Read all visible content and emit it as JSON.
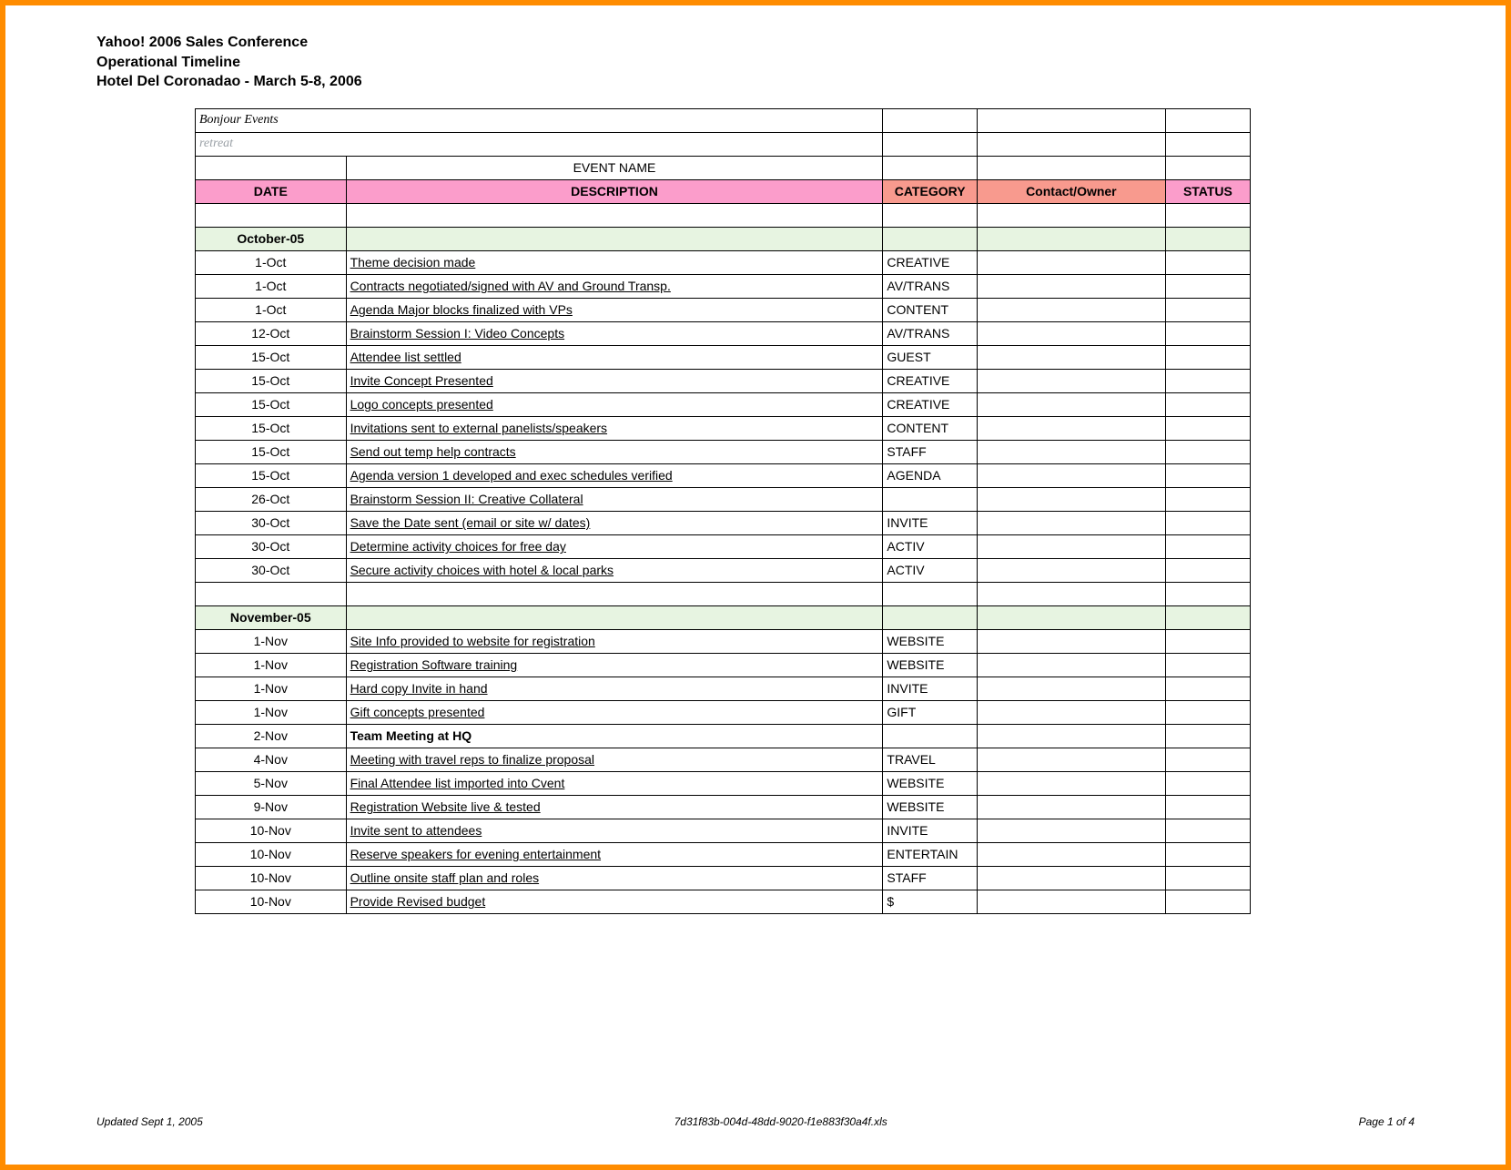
{
  "header": {
    "line1": "Yahoo! 2006 Sales Conference",
    "line2": "Operational Timeline",
    "line3": "Hotel Del Coronadao - March 5-8, 2006"
  },
  "top": {
    "brand": "Bonjour Events",
    "retreat": "retreat",
    "event_name": "EVENT NAME"
  },
  "columns": {
    "date": "DATE",
    "description": "DESCRIPTION",
    "category": "CATEGORY",
    "owner": "Contact/Owner",
    "status": "STATUS"
  },
  "sections": [
    {
      "month": "October-05",
      "rows": [
        {
          "date": "1-Oct",
          "desc": "Theme decision made",
          "cat": "CREATIVE"
        },
        {
          "date": "1-Oct",
          "desc": "Contracts negotiated/signed with AV and Ground Transp.",
          "cat": "AV/TRANS"
        },
        {
          "date": "1-Oct",
          "desc": "Agenda Major blocks finalized with VPs",
          "cat": "CONTENT"
        },
        {
          "date": "12-Oct",
          "desc": "Brainstorm Session I: Video Concepts",
          "cat": "AV/TRANS"
        },
        {
          "date": "15-Oct",
          "desc": "Attendee list settled",
          "cat": "GUEST"
        },
        {
          "date": "15-Oct",
          "desc": "Invite Concept Presented",
          "cat": "CREATIVE"
        },
        {
          "date": "15-Oct",
          "desc": "Logo concepts presented",
          "cat": "CREATIVE"
        },
        {
          "date": "15-Oct",
          "desc": "Invitations sent to external panelists/speakers",
          "cat": "CONTENT"
        },
        {
          "date": "15-Oct",
          "desc": "Send out temp help contracts",
          "cat": "STAFF"
        },
        {
          "date": "15-Oct",
          "desc": "Agenda version 1 developed and exec schedules verified",
          "cat": "AGENDA"
        },
        {
          "date": "26-Oct",
          "desc": "Brainstorm Session II: Creative Collateral",
          "cat": ""
        },
        {
          "date": "30-Oct",
          "desc": "Save the Date sent (email or site w/ dates)",
          "cat": "INVITE"
        },
        {
          "date": "30-Oct",
          "desc": "Determine activity choices for free day",
          "cat": "ACTIV"
        },
        {
          "date": "30-Oct",
          "desc": "Secure activity choices with hotel & local parks",
          "cat": "ACTIV"
        }
      ]
    },
    {
      "month": "November-05",
      "rows": [
        {
          "date": "1-Nov",
          "desc": "Site Info provided to website for registration",
          "cat": "WEBSITE"
        },
        {
          "date": "1-Nov",
          "desc": "Registration Software training",
          "cat": "WEBSITE"
        },
        {
          "date": "1-Nov",
          "desc": "Hard copy Invite in hand",
          "cat": "INVITE"
        },
        {
          "date": "1-Nov",
          "desc": "Gift concepts presented",
          "cat": "GIFT"
        },
        {
          "date": "2-Nov",
          "desc": "Team Meeting at HQ",
          "cat": "",
          "bold": true,
          "noUnderline": true
        },
        {
          "date": "4-Nov",
          "desc": "Meeting with travel reps to finalize proposal",
          "cat": "TRAVEL"
        },
        {
          "date": "5-Nov",
          "desc": "Final Attendee list imported into Cvent",
          "cat": "WEBSITE"
        },
        {
          "date": "9-Nov",
          "desc": "Registration Website live & tested",
          "cat": "WEBSITE"
        },
        {
          "date": "10-Nov",
          "desc": "Invite sent to attendees",
          "cat": "INVITE"
        },
        {
          "date": "10-Nov",
          "desc": "Reserve speakers for evening entertainment",
          "cat": "ENTERTAIN"
        },
        {
          "date": "10-Nov",
          "desc": "Outline onsite staff plan and roles",
          "cat": "STAFF"
        },
        {
          "date": "10-Nov",
          "desc": "Provide Revised budget",
          "cat": "$"
        }
      ]
    }
  ],
  "footer": {
    "left": "Updated Sept 1, 2005",
    "center": "7d31f83b-004d-48dd-9020-f1e883f30a4f.xls",
    "right": "Page 1 of 4"
  }
}
